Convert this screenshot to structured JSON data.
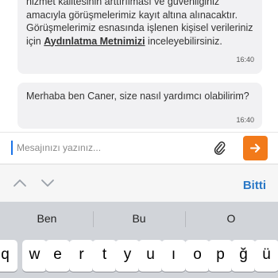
{
  "chat": {
    "message_1": {
      "text_before_link": "hizmet kalitesinin arttırılması ve güvenliğiniz amacıyla görüşmelerimiz kayıt altına alınacaktır. Görüşmelerimiz esnasında işlenen kişisel verileriniz için ",
      "link_text": "Aydınlatma Metnimizi",
      "text_after_link": " inceleyebilirsiniz.",
      "time": "16:40"
    },
    "message_2": {
      "text": "Merhaba ben Caner, size nasıl yardımcı olabilirim?",
      "time": "16:40"
    }
  },
  "composer": {
    "placeholder": "Mesajınızı yazınız...",
    "attach_icon": "paperclip-icon",
    "send_icon": "send-arrow-icon",
    "accent_color": "#f27a1a"
  },
  "accessory_bar": {
    "prev_icon": "chevron-up-icon",
    "next_icon": "chevron-down-icon",
    "done_label": "Bitti"
  },
  "keyboard": {
    "suggestions": [
      "Ben",
      "Bu",
      "O"
    ],
    "keys": [
      "q",
      "w",
      "e",
      "r",
      "t",
      "y",
      "u",
      "ı",
      "o",
      "p",
      "ğ",
      "ü"
    ]
  }
}
